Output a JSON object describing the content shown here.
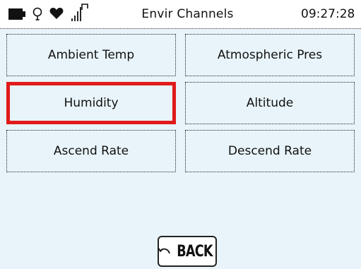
{
  "statusbar": {
    "title": "Envir Channels",
    "time": "09:27:28",
    "icons": [
      "battery-icon",
      "bulb-icon",
      "heart-icon",
      "signal-icon"
    ]
  },
  "channels": [
    {
      "label": "Ambient Temp",
      "selected": false
    },
    {
      "label": "Atmospheric Pres",
      "selected": false
    },
    {
      "label": "Humidity",
      "selected": true
    },
    {
      "label": "Altitude",
      "selected": false
    },
    {
      "label": "Ascend Rate",
      "selected": false
    },
    {
      "label": "Descend Rate",
      "selected": false
    }
  ],
  "footer": {
    "back_label": "BACK"
  },
  "colors": {
    "background": "#e8f4f9",
    "selection": "#e11a1a"
  }
}
